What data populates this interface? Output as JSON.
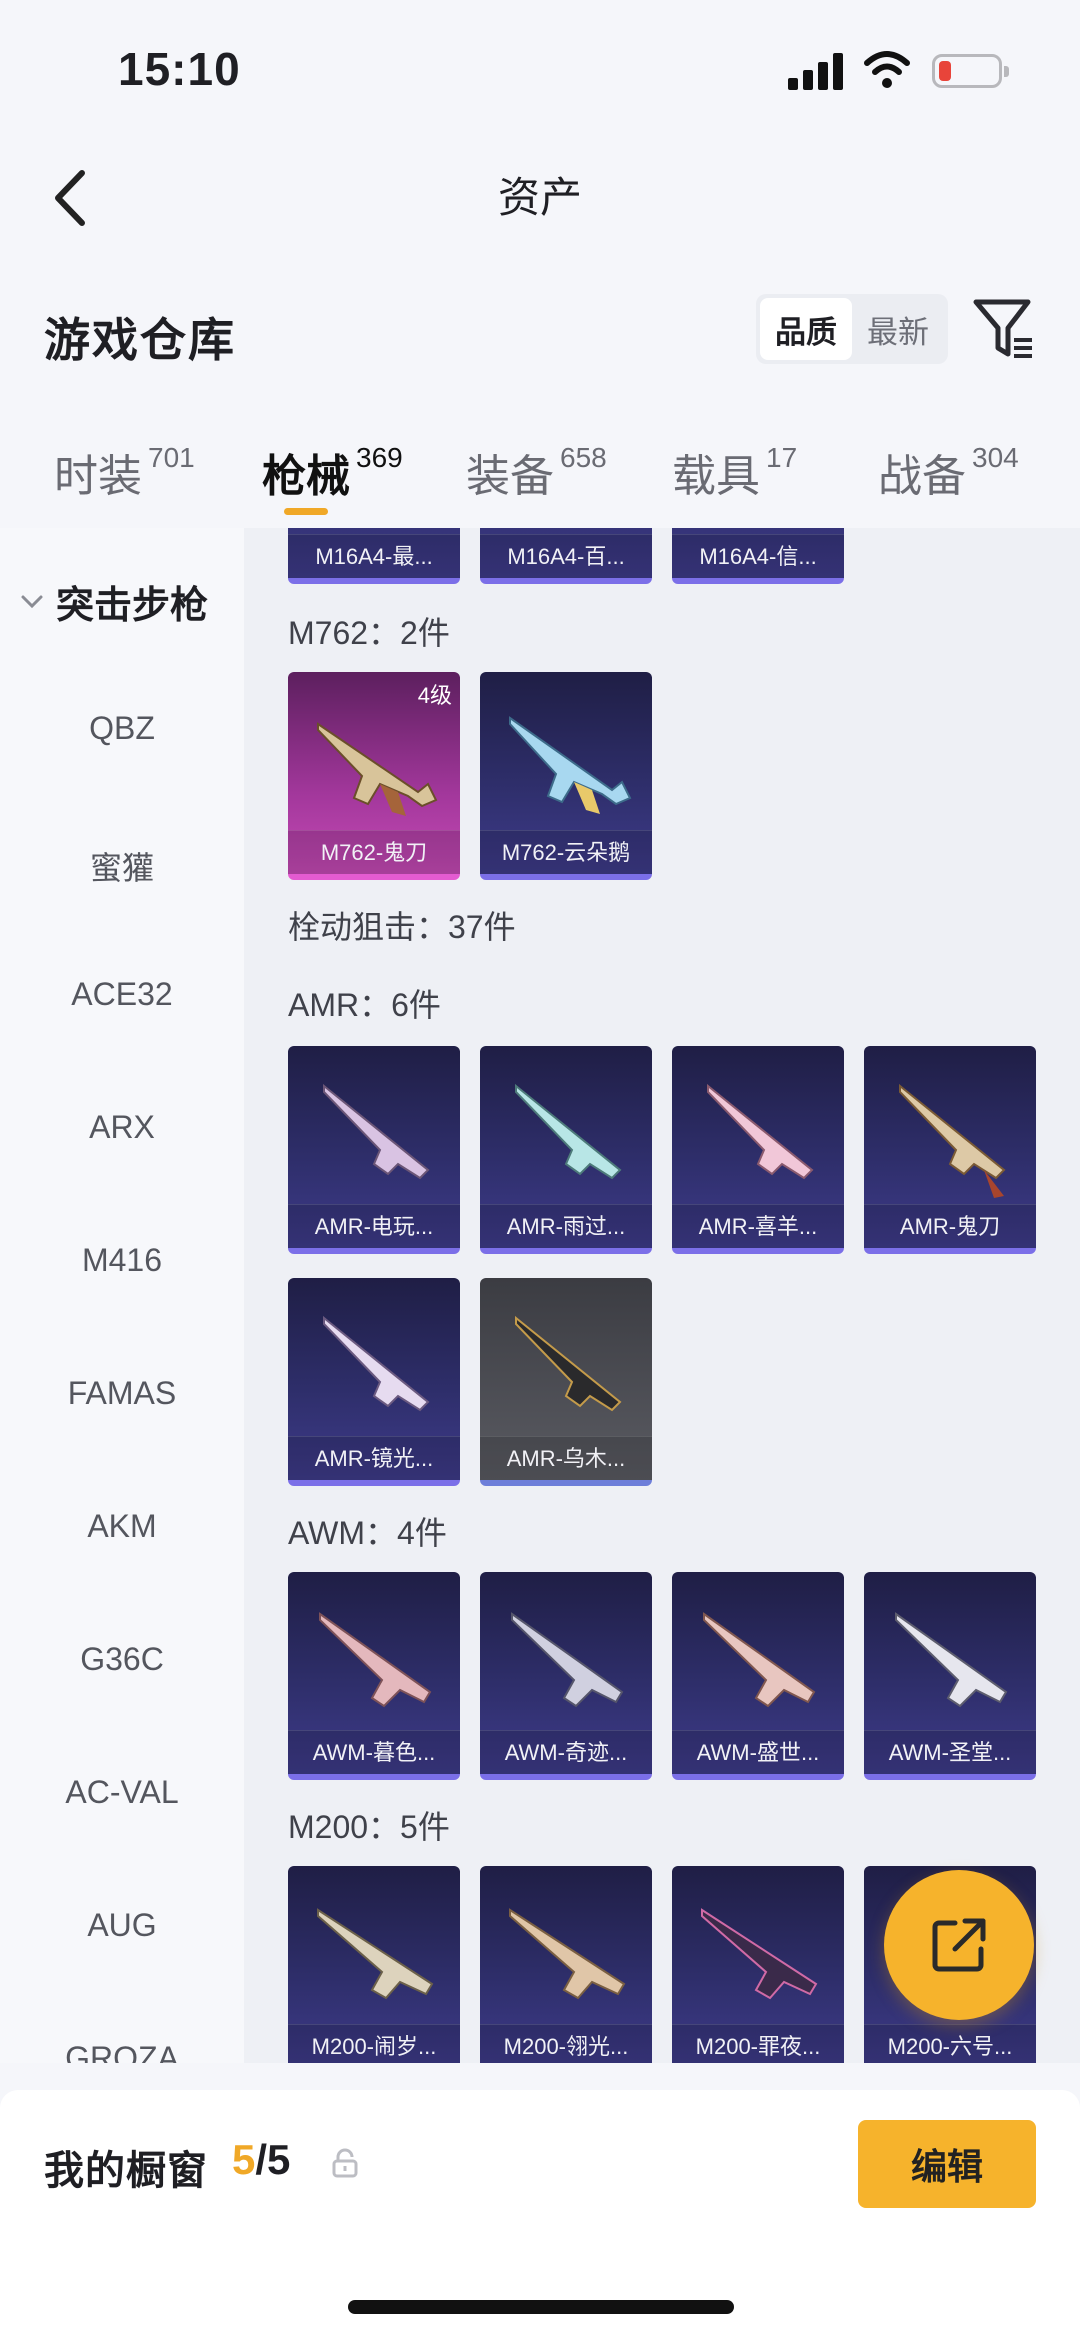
{
  "status_bar": {
    "time": "15:10"
  },
  "nav": {
    "title": "资产"
  },
  "section": {
    "title": "游戏仓库",
    "sort_options": [
      "品质",
      "最新"
    ],
    "sort_active": "品质"
  },
  "tabs": [
    {
      "label": "时装",
      "count": "701"
    },
    {
      "label": "枪械",
      "count": "369"
    },
    {
      "label": "装备",
      "count": "658"
    },
    {
      "label": "载具",
      "count": "17"
    },
    {
      "label": "战备",
      "count": "304"
    }
  ],
  "sidebar": {
    "group_label": "突击步枪",
    "items": [
      "QBZ",
      "蜜獾",
      "ACE32",
      "ARX",
      "M416",
      "FAMAS",
      "AKM",
      "G36C",
      "AC-VAL",
      "AUG",
      "GROZA"
    ]
  },
  "grid": {
    "partial_row": [
      "M16A4-最...",
      "M16A4-百...",
      "M16A4-信..."
    ],
    "m762_header": "M762：2件",
    "m762_items": [
      {
        "name": "M762-鬼刀",
        "badge": "4级"
      },
      {
        "name": "M762-云朵鹅"
      }
    ],
    "sniper_header": "栓动狙击：37件",
    "amr_header": "AMR：6件",
    "amr_items": [
      "AMR-电玩...",
      "AMR-雨过...",
      "AMR-喜羊...",
      "AMR-鬼刀",
      "AMR-镜光...",
      "AMR-乌木..."
    ],
    "awm_header": "AWM：4件",
    "awm_items": [
      "AWM-暮色...",
      "AWM-奇迹...",
      "AWM-盛世...",
      "AWM-圣堂..."
    ],
    "m200_header": "M200：5件",
    "m200_items": [
      "M200-闹岁...",
      "M200-翎光...",
      "M200-罪夜...",
      "M200-六号..."
    ]
  },
  "bottom": {
    "showcase_label": "我的橱窗",
    "showcase_current": "5",
    "showcase_total": "/5",
    "edit_label": "编辑"
  }
}
